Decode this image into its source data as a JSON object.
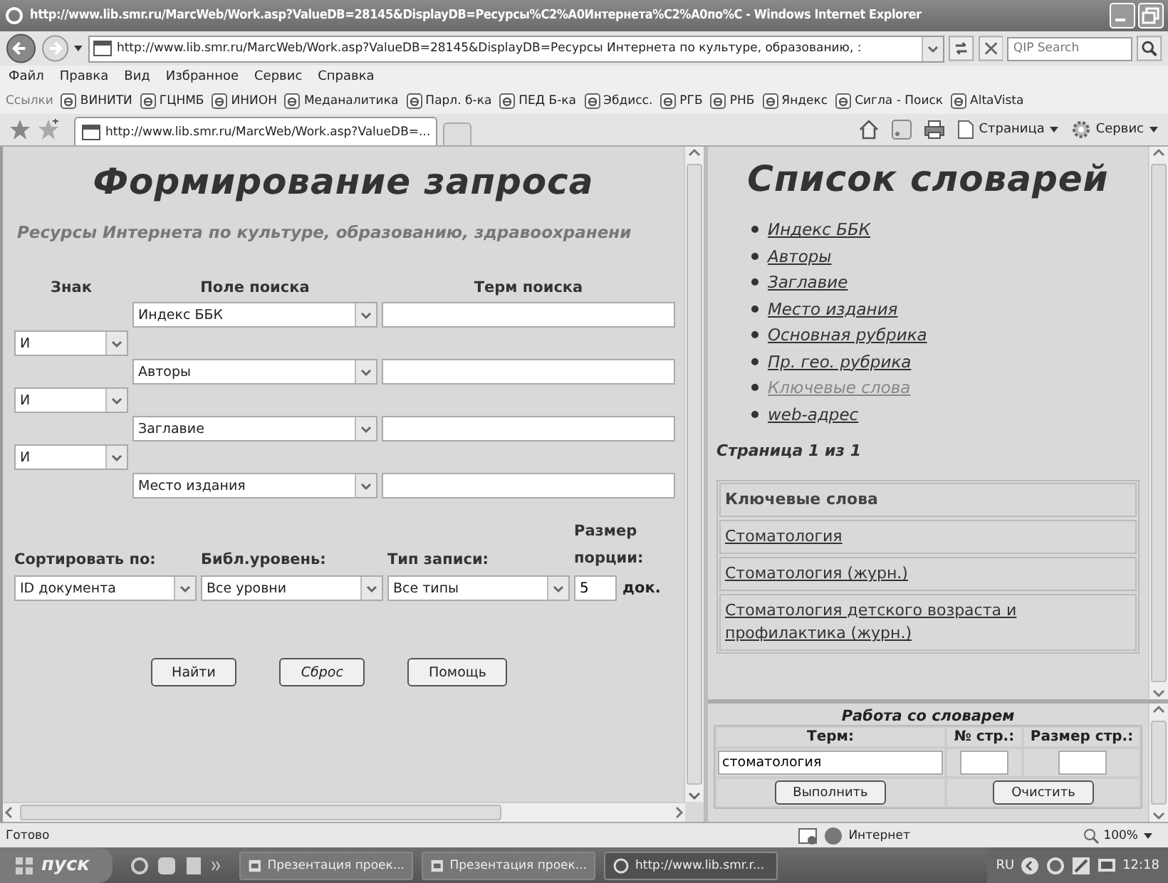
{
  "window": {
    "title": "http://www.lib.smr.ru/MarcWeb/Work.asp?ValueDB=28145&DisplayDB=Ресурсы%C2%A0Интернета%C2%A0по%C - Windows Internet Explorer"
  },
  "address_bar": {
    "url": "http://www.lib.smr.ru/MarcWeb/Work.asp?ValueDB=28145&DisplayDB=Ресурсы Интернета по культуре, образованию, :",
    "search_placeholder": "QIP Search"
  },
  "menu": [
    "Файл",
    "Правка",
    "Вид",
    "Избранное",
    "Сервис",
    "Справка"
  ],
  "links_bar": {
    "label": "Ссылки",
    "items": [
      "ВИНИТИ",
      "ГЦНМБ",
      "ИНИОН",
      "Меданалитика",
      "Парл. б-ка",
      "ПЕД Б-ка",
      "Эбдисс.",
      "РГБ",
      "РНБ",
      "Яндекс",
      "Сигла - Поиск",
      "AltaVista"
    ]
  },
  "tab": {
    "title": "http://www.lib.smr.ru/MarcWeb/Work.asp?ValueDB=..."
  },
  "command_bar": [
    "Страница",
    "Сервис"
  ],
  "query_form": {
    "title": "Формирование запроса",
    "subtitle": "Ресурсы Интернета по культуре, образованию, здравоохранени",
    "headers": [
      "Знак",
      "Поле поиска",
      "Терм поиска"
    ],
    "fields": [
      {
        "field": "Индекс ББК"
      },
      {
        "field": "Авторы"
      },
      {
        "field": "Заглавие"
      },
      {
        "field": "Место издания"
      }
    ],
    "operators": [
      "И",
      "И",
      "И"
    ],
    "options": [
      {
        "label": "Сортировать по:",
        "value": "ID документа"
      },
      {
        "label": "Библ.уровень:",
        "value": "Все уровни"
      },
      {
        "label": "Тип записи:",
        "value": "Все типы"
      }
    ],
    "portion": {
      "label": "Размер порции:",
      "value": "5",
      "unit": "док."
    },
    "buttons": [
      "Найти",
      "Сброс",
      "Помощь"
    ]
  },
  "dictionary_list": {
    "title": "Список словарей",
    "items": [
      {
        "label": "Индекс ББК",
        "visited": false
      },
      {
        "label": "Авторы",
        "visited": false
      },
      {
        "label": "Заглавие",
        "visited": false
      },
      {
        "label": "Место издания",
        "visited": false
      },
      {
        "label": "Основная рубрика",
        "visited": false
      },
      {
        "label": "Пр. гео. рубрика",
        "visited": false
      },
      {
        "label": "Ключевые слова",
        "visited": true
      },
      {
        "label": "web-адрес",
        "visited": false
      }
    ],
    "page_info": "Страница 1 из 1",
    "table_header": "Ключевые слова",
    "terms": [
      "Стоматология",
      "Стоматология (журн.)",
      "Стоматология детского возраста и профилактика (журн.)"
    ]
  },
  "dictionary_work": {
    "title": "Работа со словарем",
    "columns": [
      "Терм:",
      "№ стр.:",
      "Размер стр.:"
    ],
    "term": "стоматология",
    "buttons": [
      "Выполнить",
      "Очистить"
    ]
  },
  "status_bar": {
    "text": "Готово",
    "zone": "Интернет",
    "zoom": "100%"
  },
  "taskbar": {
    "start": "пуск",
    "tasks": [
      "Презентация проек...",
      "Презентация проек...",
      "http://www.lib.smr.r..."
    ],
    "language": "RU",
    "clock": "12:18"
  }
}
